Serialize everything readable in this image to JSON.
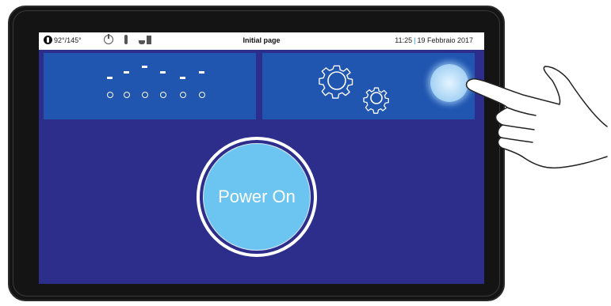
{
  "status_bar": {
    "temperature": "92°/145°",
    "page_title": "Initial page",
    "time": "11:25",
    "separator": "|",
    "date": "19 Febbraio 2017",
    "icons": [
      "thermometer-icon",
      "power-icon",
      "bottle-icon",
      "cups-icon"
    ]
  },
  "tiles": {
    "drinks": {
      "icon": "drink-selection-icon"
    },
    "settings": {
      "icon": "gears-icon"
    }
  },
  "power_button": {
    "label": "Power On"
  },
  "colors": {
    "background": "#2d2d8c",
    "tile": "#2055b0",
    "power_button": "#6cc5f0",
    "accent_separator": "#2e8bd8"
  }
}
